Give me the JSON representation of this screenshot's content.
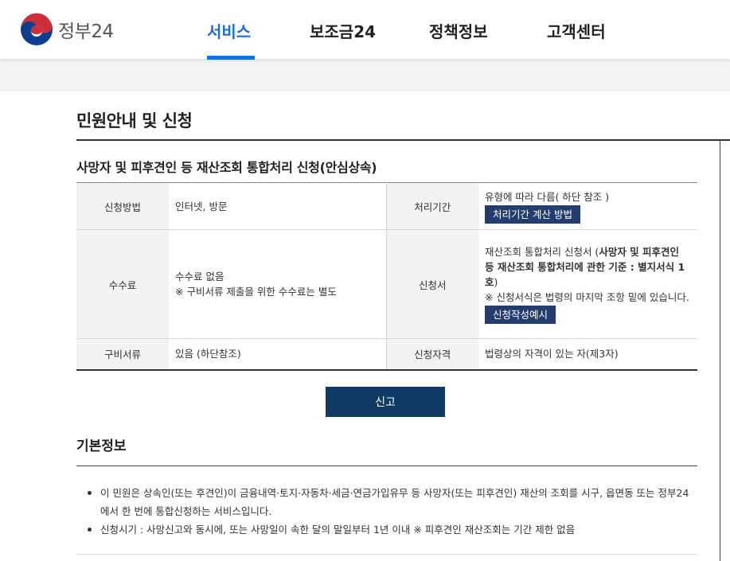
{
  "header": {
    "logo_text": "정부24",
    "nav": [
      "서비스",
      "보조금24",
      "정책정보",
      "고객센터"
    ],
    "active_color": "#1a6fe0"
  },
  "page": {
    "title": "민원안내 및 신청",
    "service_title": "사망자 및 피후견인 등 재산조회 통합처리 신청(안심상속)"
  },
  "info": {
    "method_label": "신청방법",
    "method_value": "인터넷, 방문",
    "period_label": "처리기간",
    "period_value": "유형에 따라 다름( 하단 참조 )",
    "period_button": "처리기간 계산 방법",
    "fee_label": "수수료",
    "fee_value_1": "수수료 없음",
    "fee_value_2": "※ 구비서류 제출을 위한 수수료는 별도",
    "form_label": "신청서",
    "form_value_prefix": "재산조회 통합처리 신청서 (",
    "form_value_bold": "사망자 및 피후견인 등 재산조회 통합처리에 관한 기준 : 별지서식 1호",
    "form_value_suffix": ")",
    "form_note": "※ 신청서식은 법령의 마지막 조항 밑에 있습니다.",
    "form_button": "신청작성예시",
    "docs_label": "구비서류",
    "docs_value": "있음 (하단참조)",
    "qual_label": "신청자격",
    "qual_value": "법령상의 자격이 있는 자(제3자)",
    "button_color": "#233e6e"
  },
  "actions": {
    "report_button": "신고",
    "report_color": "#0f3a63"
  },
  "basic": {
    "title": "기본정보",
    "items": [
      "이 민원은 상속인(또는 후견인)이 금융내역·토지·자동차·세금·연금가입유무 등 사망자(또는 피후견인) 재산의 조회를 시구, 읍면동 또는 정부24에서 한 번에 통합신청하는 서비스입니다.",
      "신청시기 : 사망신고와 동시에, 또는 사망일이 속한 달의 말일부터 1년 이내 ※ 피후견인 재산조회는 기간 제한 없음"
    ]
  },
  "icons": {
    "logo": "taegeuk-logo-icon"
  }
}
